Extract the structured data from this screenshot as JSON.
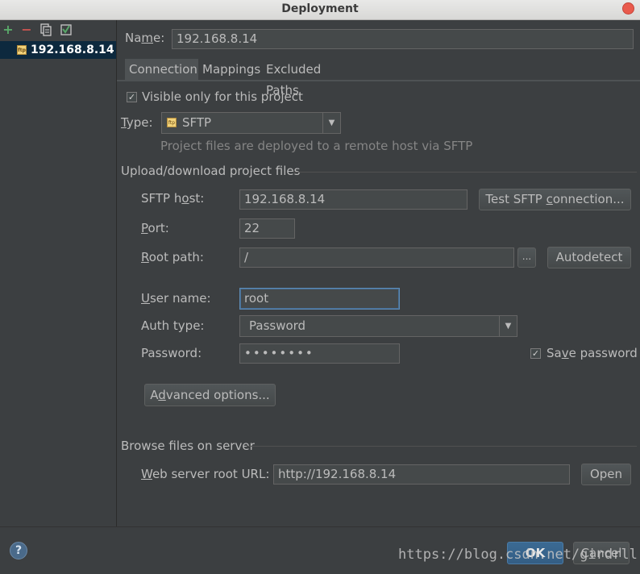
{
  "window": {
    "title": "Deployment"
  },
  "toolbar": {
    "add_icon": "plus-icon",
    "remove_icon": "minus-icon",
    "copy_icon": "copy-icon",
    "default_icon": "set-default-icon"
  },
  "servers": [
    {
      "label": "192.168.8.14",
      "icon": "sftp-icon"
    }
  ],
  "name": {
    "label_pre": "Na",
    "label_mnemonic": "m",
    "label_post": "e:",
    "value": "192.168.8.14"
  },
  "tabs": [
    {
      "label": "Connection"
    },
    {
      "label": "Mappings"
    },
    {
      "label": "Excluded Paths"
    }
  ],
  "connection": {
    "visible_only": {
      "label": "Visible only for this project",
      "checked": true
    },
    "type": {
      "label_mnemonic": "T",
      "label_post": "ype:",
      "value": "SFTP",
      "description": "Project files are deployed to a remote host via SFTP"
    },
    "upload_section": "Upload/download project files",
    "sftp_host": {
      "label_pre": "SFTP h",
      "label_mnemonic": "o",
      "label_post": "st:",
      "value": "192.168.8.14"
    },
    "test_button": {
      "pre": "Test SFTP ",
      "mnemonic": "c",
      "post": "onnection..."
    },
    "port": {
      "label_mnemonic": "P",
      "label_post": "ort:",
      "value": "22"
    },
    "root_path": {
      "label_mnemonic": "R",
      "label_post": "oot path:",
      "value": "/",
      "browse": "...",
      "autodetect": "Autodetect"
    },
    "user_name": {
      "label_mnemonic": "U",
      "label_post": "ser name:",
      "value": "root"
    },
    "auth_type": {
      "label": "Auth type:",
      "value": "Password"
    },
    "password": {
      "label": "Password:",
      "value": "••••••••"
    },
    "save_password": {
      "label_pre": "Sa",
      "label_mnemonic": "v",
      "label_post": "e password",
      "checked": true
    },
    "advanced_button": {
      "pre": "A",
      "mnemonic": "d",
      "post": "vanced options..."
    },
    "browse_section": "Browse files on server",
    "web_root": {
      "label_mnemonic": "W",
      "label_post": "eb server root URL:",
      "value": "http://192.168.8.14",
      "open": "Open"
    }
  },
  "footer": {
    "help": "?",
    "ok": "OK",
    "cancel": "Cancel"
  },
  "watermark": "https://blog.csdn.net/girdrll",
  "colors": {
    "background": "#3c3f41",
    "selection": "#0d293e",
    "field": "#45494a",
    "text": "#bbbbbb",
    "add": "#59a869",
    "remove": "#c75450",
    "close": "#e95a4c"
  }
}
